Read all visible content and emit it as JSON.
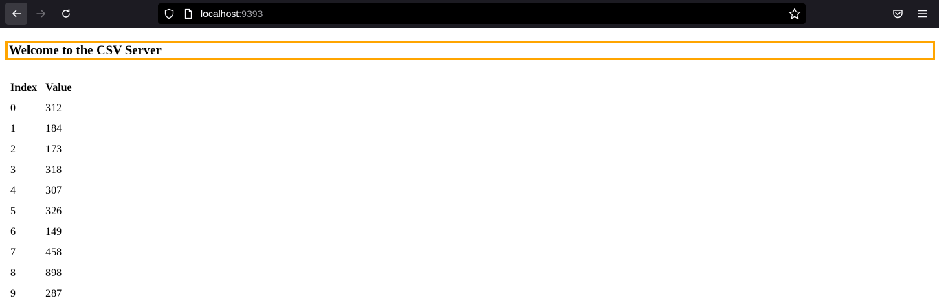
{
  "browser": {
    "url_host": "localhost",
    "url_port": ":9393",
    "icons": [
      "back-arrow-icon",
      "forward-arrow-icon",
      "reload-icon",
      "shield-icon",
      "page-icon",
      "star-icon",
      "pocket-icon",
      "menu-icon"
    ]
  },
  "page": {
    "heading": "Welcome to the CSV Server",
    "heading_border_color": "#ffa500",
    "table": {
      "headers": [
        "Index",
        "Value"
      ],
      "rows": [
        [
          "0",
          "312"
        ],
        [
          "1",
          "184"
        ],
        [
          "2",
          "173"
        ],
        [
          "3",
          "318"
        ],
        [
          "4",
          "307"
        ],
        [
          "5",
          "326"
        ],
        [
          "6",
          "149"
        ],
        [
          "7",
          "458"
        ],
        [
          "8",
          "898"
        ],
        [
          "9",
          "287"
        ]
      ]
    }
  }
}
